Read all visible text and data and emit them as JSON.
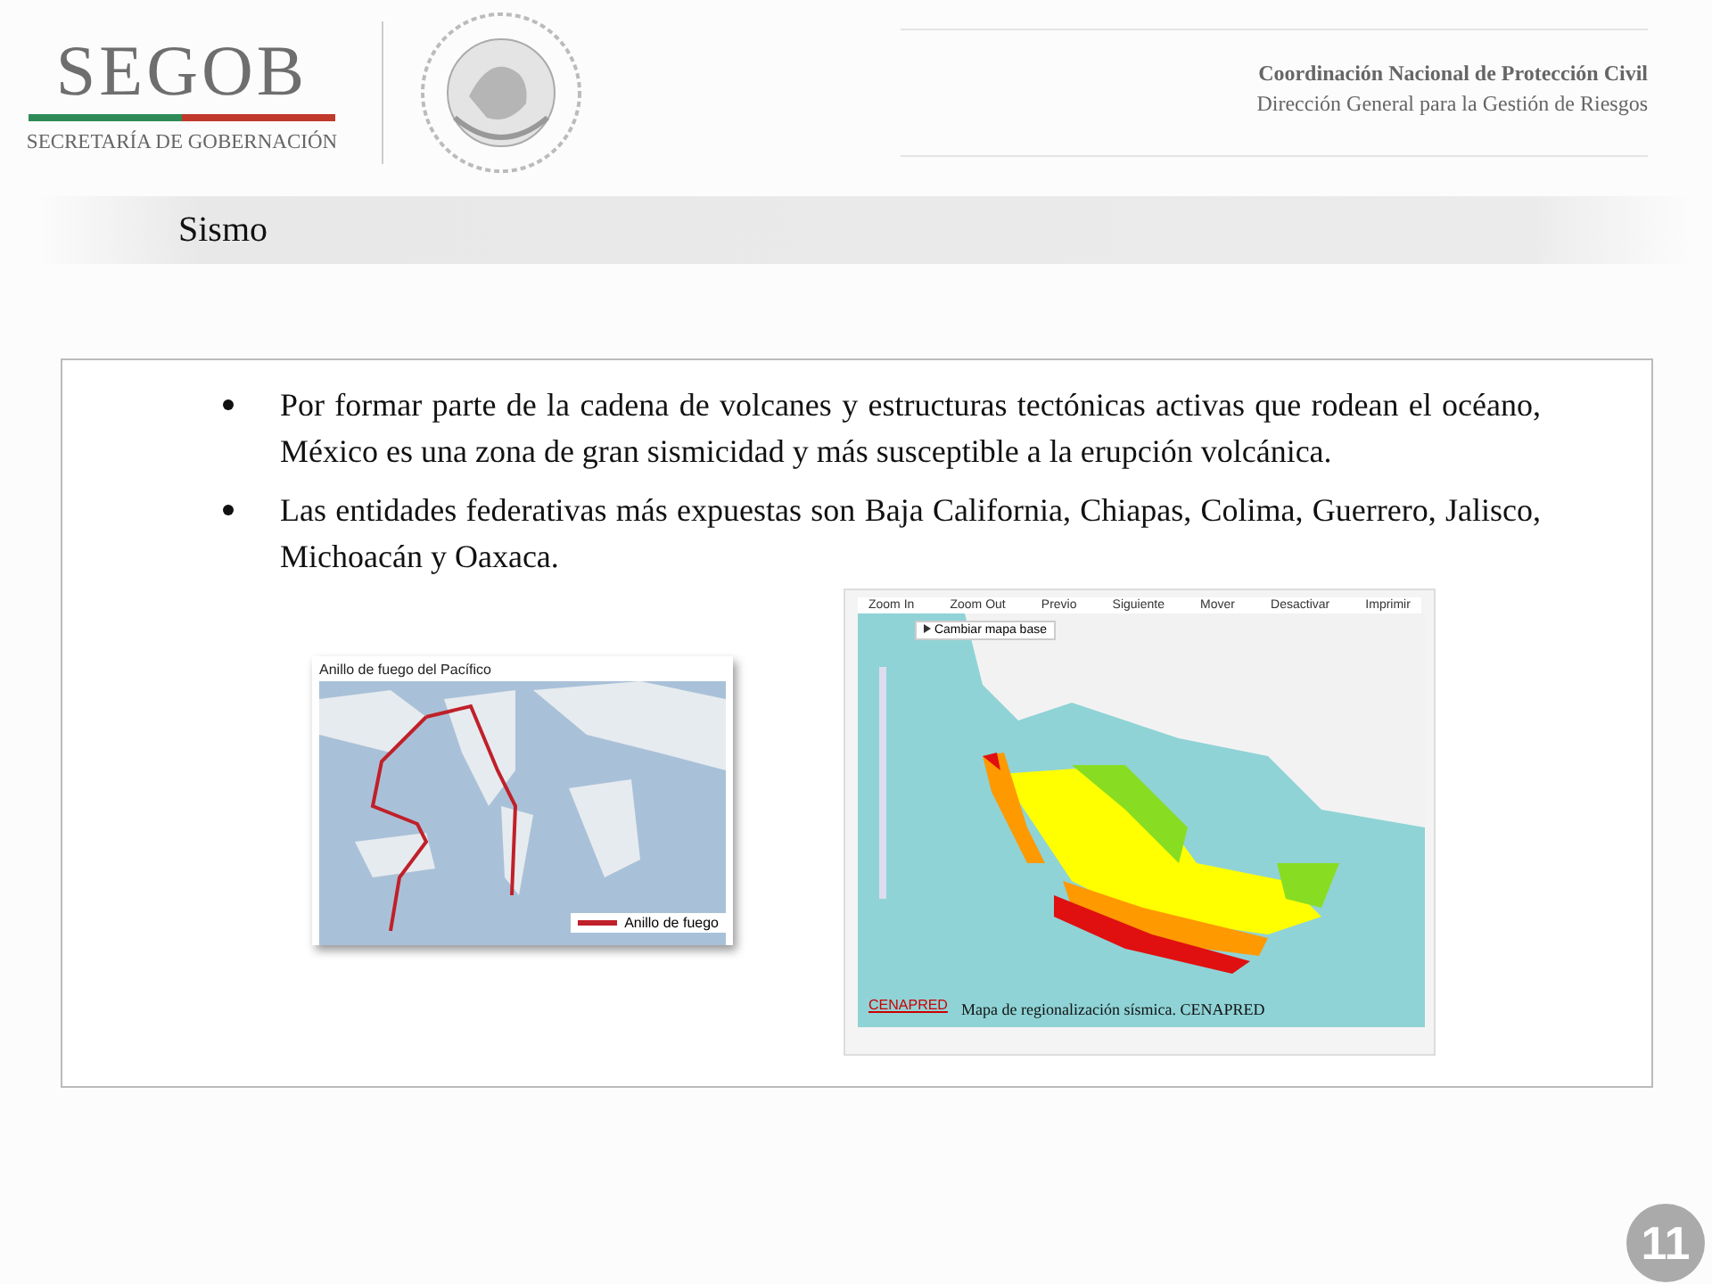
{
  "header": {
    "wordmark": "SEGOB",
    "subtitle": "SECRETARÍA DE GOBERNACIÓN",
    "org_lines": [
      "Coordinación Nacional de Protección Civil",
      "Dirección General para la Gestión de Riesgos"
    ]
  },
  "title": "Sismo",
  "bullets": [
    "Por formar parte de la cadena de volcanes y estructuras tectónicas activas que rodean  el océano, México es una zona de gran sismicidad y más susceptible a la erupción volcánica.",
    "Las entidades federativas más expuestas son Baja California, Chiapas, Colima, Guerrero, Jalisco, Michoacán y Oaxaca."
  ],
  "ring_map": {
    "title": "Anillo de fuego del Pacífico",
    "legend": "Anillo de fuego"
  },
  "seismic_map": {
    "toolbar": [
      "Zoom In",
      "Zoom Out",
      "Previo",
      "Siguiente",
      "Mover",
      "Desactivar",
      "Imprimir"
    ],
    "base_map_button": "Cambiar mapa base",
    "logo": "CENAPRED",
    "caption": "Mapa de regionalización sísmica. CENAPRED"
  },
  "page_number": "11"
}
